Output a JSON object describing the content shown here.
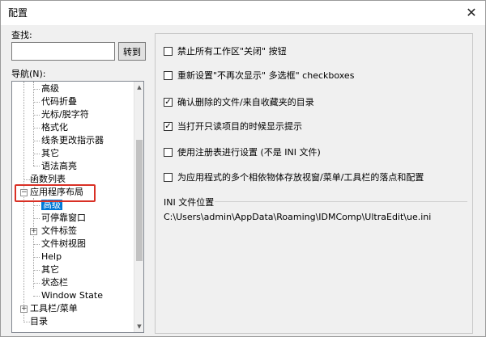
{
  "window": {
    "title": "配置",
    "close": "✕"
  },
  "search": {
    "label": "查找:",
    "value": "",
    "goto_label": "转到"
  },
  "nav": {
    "label": "导航(N):",
    "items": [
      "高级",
      "代码折叠",
      "光标/脱字符",
      "格式化",
      "线条更改指示器",
      "其它",
      "语法高亮",
      "函数列表",
      "应用程序布局",
      "高级",
      "可停靠窗口",
      "文件标签",
      "文件树视图",
      "Help",
      "其它",
      "状态栏",
      "Window State",
      "工具栏/菜单",
      "目录"
    ]
  },
  "options": [
    {
      "label": "禁止所有工作区\"关闭\" 按钮",
      "checked": false
    },
    {
      "label": "重新设置\"不再次显示\" 多选框\" checkboxes",
      "checked": false
    },
    {
      "label": "确认删除的文件/来自收藏夹的目录",
      "checked": true
    },
    {
      "label": "当打开只读项目的时候显示提示",
      "checked": true
    },
    {
      "label": "使用注册表进行设置 (不是 INI 文件)",
      "checked": false
    },
    {
      "label": "为应用程式的多个相依物体存放视窗/菜单/工具栏的落点和配置",
      "checked": false
    }
  ],
  "ini": {
    "label": "INI 文件位置",
    "path": "C:\\Users\\admin\\AppData\\Roaming\\IDMComp\\UltraEdit\\ue.ini"
  },
  "colors": {
    "selection": "#0078d7",
    "highlight_box": "#d93025"
  }
}
